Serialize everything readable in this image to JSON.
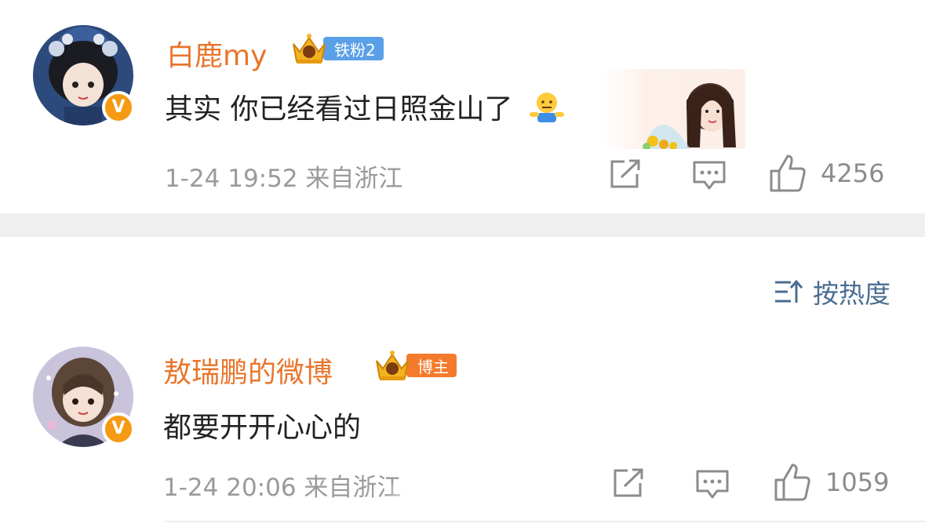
{
  "comments": [
    {
      "username": "白鹿my",
      "badge_label": "铁粉2",
      "badge_color": "#5aa0e8",
      "verified_mark": "V",
      "text": "其实 你已经看过日照金山了",
      "emoji": "shrug-emoji",
      "date": "1-24",
      "time": "19:52",
      "location": "来自浙江",
      "likes": "4256"
    },
    {
      "username": "敖瑞鹏的微博",
      "badge_label": "博主",
      "badge_color": "#f57b2c",
      "verified_mark": "V",
      "text": "都要开开心心的",
      "date": "1-24",
      "time": "20:06",
      "location": "来自浙江",
      "likes": "1059"
    }
  ],
  "sort": {
    "label": "按热度",
    "icon": "sort-icon"
  },
  "colors": {
    "username": "#e8762c",
    "meta": "#9a9a9a",
    "sort_accent": "#4a6e91",
    "verified": "#f59a12"
  }
}
